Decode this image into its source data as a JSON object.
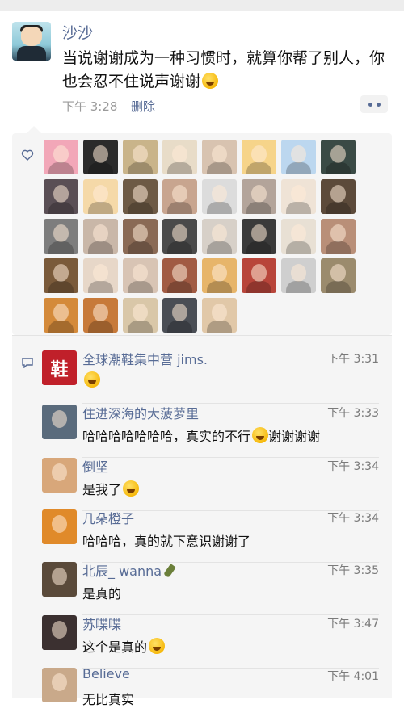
{
  "post": {
    "author": "沙沙",
    "text": "当说谢谢成为一种习惯时，就算你帮了别人，你也会忍不住说声谢谢",
    "time": "下午 3:28",
    "delete_label": "删除"
  },
  "likes": {
    "avatar_colors": [
      [
        "#f2a7b8",
        "#2b2b2b",
        "#c9b48a",
        "#e8dcc8",
        "#d8c3b0",
        "#f6d48a",
        "#bcd7ef",
        "#3a4a45"
      ],
      [
        "#5a4f55",
        "#f5d9a8",
        "#6d5a45",
        "#c8a58f",
        "#dcdcdc",
        "#b3a49a",
        "#efe3d6",
        "#5c4a3a"
      ],
      [
        "#7d7d7d",
        "#c9b7a8",
        "#8a6a55",
        "#4a4a4a",
        "#d7d0c8",
        "#3a3a3a",
        "#e8e0d4",
        "#b98f78"
      ],
      [
        "#7a5a3a",
        "#e7d7c8",
        "#d8c4b4",
        "#a15b43",
        "#e7b56a",
        "#b8453a",
        "#cfcfcf",
        "#9b8b6d"
      ],
      [
        "#d48a3a",
        "#c77a3a",
        "#d9c7a8",
        "#4a4e55",
        "#e1c8a8"
      ]
    ]
  },
  "comments": [
    {
      "nick": "全球潮鞋集中营 jims.",
      "time": "下午 3:31",
      "text": "",
      "avatar_label": "鞋",
      "avatar_color": "#c0202a"
    },
    {
      "nick": "住进深海的大菠萝里",
      "time": "下午 3:33",
      "text": "哈哈哈哈哈哈哈，真实的不行",
      "text_after": "谢谢谢谢",
      "avatar_color": "#5a6b7c"
    },
    {
      "nick": "倒坚",
      "time": "下午 3:34",
      "text": "是我了",
      "avatar_color": "#d8a77a"
    },
    {
      "nick": "几朵橙子",
      "time": "下午 3:34",
      "text": "哈哈哈，真的就下意识谢谢了",
      "avatar_color": "#e08a2a"
    },
    {
      "nick": "北辰_ wanna",
      "time": "下午 3:35",
      "text": "是真的",
      "avatar_color": "#5a4a3a"
    },
    {
      "nick": "苏喋喋",
      "time": "下午 3:47",
      "text": "这个是真的",
      "avatar_color": "#3b3030"
    },
    {
      "nick": "Believe",
      "time": "下午 4:01",
      "text": "无比真实",
      "avatar_color": "#c9a98a"
    }
  ]
}
